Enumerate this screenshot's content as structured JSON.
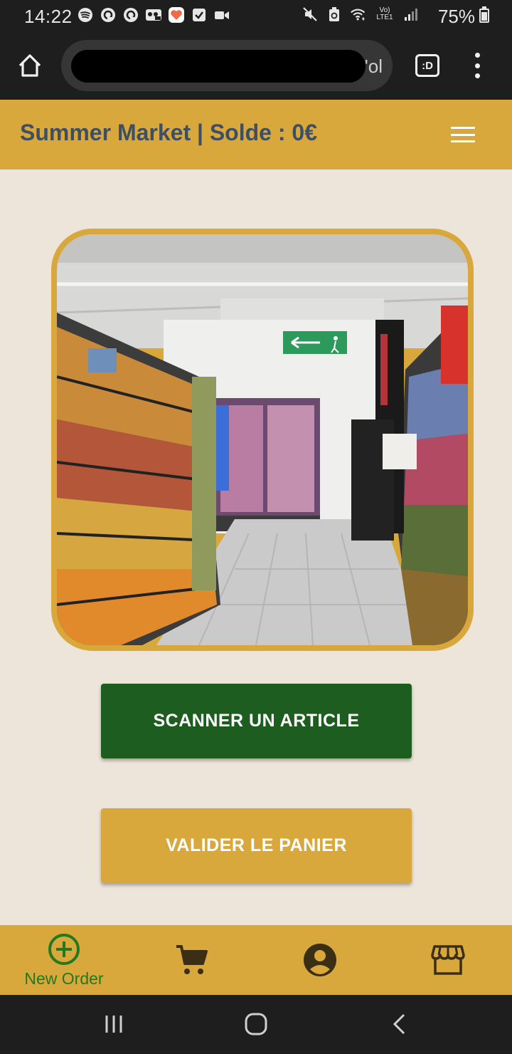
{
  "status_bar": {
    "time": "14:22",
    "battery": "75%",
    "icons_left": [
      "spotify-icon",
      "sync-icon",
      "sync-icon",
      "voicemail-icon",
      "health-icon",
      "check-icon",
      "video-icon"
    ],
    "icons_right": [
      "mute-icon",
      "recycle-icon",
      "wifi-icon",
      "volte-icon",
      "signal-icon"
    ]
  },
  "browser": {
    "url_visible_fragment": "'ol",
    "tabs_label": ":D"
  },
  "header": {
    "title": "Summer Market | Solde : 0€"
  },
  "main": {
    "photo_alt": "supermarket-aisle-photo",
    "scan_button": "SCANNER UN ARTICLE",
    "validate_button": "VALIDER LE PANIER"
  },
  "bottom_nav": {
    "items": [
      {
        "label": "New Order",
        "icon": "add-circle-icon",
        "active": true
      },
      {
        "label": "",
        "icon": "cart-icon",
        "active": false
      },
      {
        "label": "",
        "icon": "account-icon",
        "active": false
      },
      {
        "label": "",
        "icon": "store-icon",
        "active": false
      }
    ]
  },
  "colors": {
    "accent": "#d9a83c",
    "header_text": "#3e4f63",
    "primary_button": "#1d5e20",
    "active_nav": "#217a1f",
    "inactive_nav": "#3a2e14",
    "background": "#ede4da"
  }
}
